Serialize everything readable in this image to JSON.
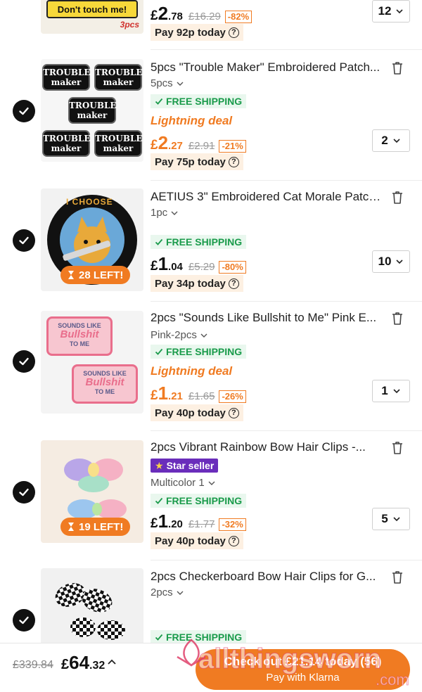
{
  "items": [
    {
      "price_cur": "£",
      "price_big": "2",
      "price_dec": ".78",
      "price_was": "£16.29",
      "discount": "-82%",
      "pay_today": "Pay 92p today",
      "qty": "12",
      "thumb_text": "Don't touch me!",
      "thumb_note": "3pcs"
    },
    {
      "title": "5pcs \"Trouble Maker\" Embroidered Patch...",
      "variant": "5pcs",
      "shipping": "FREE SHIPPING",
      "deal": "Lightning deal",
      "price_cur": "£",
      "price_big": "2",
      "price_dec": ".27",
      "price_was": "£2.91",
      "discount": "-21%",
      "pay_today": "Pay 75p today",
      "qty": "2",
      "patch_line1": "TROUBLE",
      "patch_line2": "maker"
    },
    {
      "title": "AETIUS 3\" Embroidered Cat Morale Patch...",
      "variant": "1pc",
      "shipping": "FREE SHIPPING",
      "price_cur": "£",
      "price_big": "1",
      "price_dec": ".04",
      "price_was": "£5.29",
      "discount": "-80%",
      "pay_today": "Pay 34p today",
      "qty": "10",
      "stock_badge": "28 LEFT!",
      "patch_text": "I CHOOSE"
    },
    {
      "title": "2pcs \"Sounds Like Bullshit to Me\" Pink E...",
      "variant": "Pink-2pcs",
      "shipping": "FREE SHIPPING",
      "deal": "Lightning deal",
      "price_cur": "£",
      "price_big": "1",
      "price_dec": ".21",
      "price_was": "£1.65",
      "discount": "-26%",
      "pay_today": "Pay 40p today",
      "qty": "1",
      "patch_top": "SOUNDS LIKE",
      "patch_mid": "Bullshit",
      "patch_bot": "TO ME"
    },
    {
      "title": "2pcs Vibrant Rainbow Bow Hair Clips -...",
      "star_seller": "Star seller",
      "variant": "Multicolor 1",
      "shipping": "FREE SHIPPING",
      "price_cur": "£",
      "price_big": "1",
      "price_dec": ".20",
      "price_was": "£1.77",
      "discount": "-32%",
      "pay_today": "Pay 40p today",
      "qty": "5",
      "stock_badge": "19 LEFT!"
    },
    {
      "title": "2pcs Checkerboard Bow Hair Clips for G...",
      "variant": "2pcs",
      "shipping": "FREE SHIPPING"
    }
  ],
  "footer": {
    "total_was": "£339.84",
    "total_cur": "£",
    "total_big": "64",
    "total_dec": ".32",
    "checkout_line1": "Check out £21.14 today (56)",
    "checkout_line2": "Pay with Klarna"
  },
  "watermark": {
    "text": "allthingsworn",
    "suffix": ".com"
  },
  "colors": {
    "accent": "#f07b22",
    "ship_green": "#1a9b4b",
    "star_purple": "#6a2dbb"
  }
}
